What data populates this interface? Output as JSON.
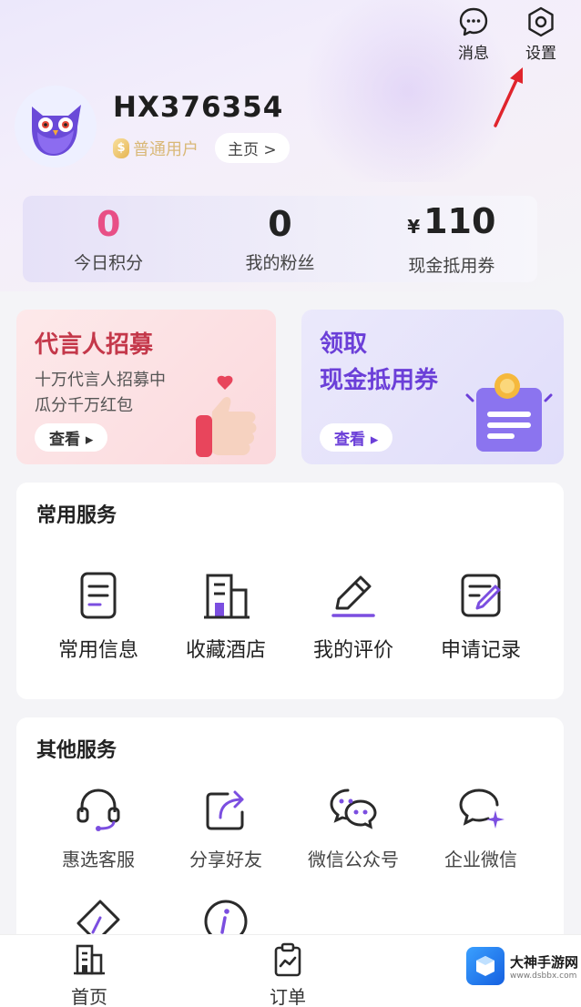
{
  "top_actions": {
    "messages_label": "消息",
    "settings_label": "设置"
  },
  "profile": {
    "username": "HX376354",
    "level": "普通用户",
    "home_link": "主页 >"
  },
  "stats": [
    {
      "value": "0",
      "label": "今日积分"
    },
    {
      "value": "0",
      "label": "我的粉丝"
    },
    {
      "currency": "¥",
      "value": "110",
      "label": "现金抵用券"
    }
  ],
  "promos": {
    "left": {
      "title": "代言人招募",
      "subtitle_line1": "十万代言人招募中",
      "subtitle_line2": "瓜分千万红包",
      "button": "查看 ▸"
    },
    "right": {
      "title_line1": "领取",
      "title_line2": "现金抵用券",
      "button": "查看 ▸"
    }
  },
  "common_services": {
    "title": "常用服务",
    "items": [
      {
        "label": "常用信息",
        "icon": "document-icon"
      },
      {
        "label": "收藏酒店",
        "icon": "building-icon"
      },
      {
        "label": "我的评价",
        "icon": "pencil-icon"
      },
      {
        "label": "申请记录",
        "icon": "edit-note-icon"
      }
    ]
  },
  "other_services": {
    "title": "其他服务",
    "items": [
      {
        "label": "惠选客服",
        "icon": "headset-icon"
      },
      {
        "label": "分享好友",
        "icon": "share-icon"
      },
      {
        "label": "微信公众号",
        "icon": "wechat-icon"
      },
      {
        "label": "企业微信",
        "icon": "work-wechat-icon"
      },
      {
        "label": "",
        "icon": "ticket-icon"
      },
      {
        "label": "",
        "icon": "info-icon"
      }
    ]
  },
  "tabbar": {
    "items": [
      {
        "label": "首页",
        "icon": "home-building-icon"
      },
      {
        "label": "订单",
        "icon": "order-clipboard-icon"
      }
    ]
  },
  "watermark": {
    "title": "大神手游网",
    "subtitle": "www.dsbbx.com"
  },
  "colors": {
    "accent_purple": "#6b3fd8",
    "accent_pink": "#e84f86",
    "promo_red": "#c4384a"
  }
}
